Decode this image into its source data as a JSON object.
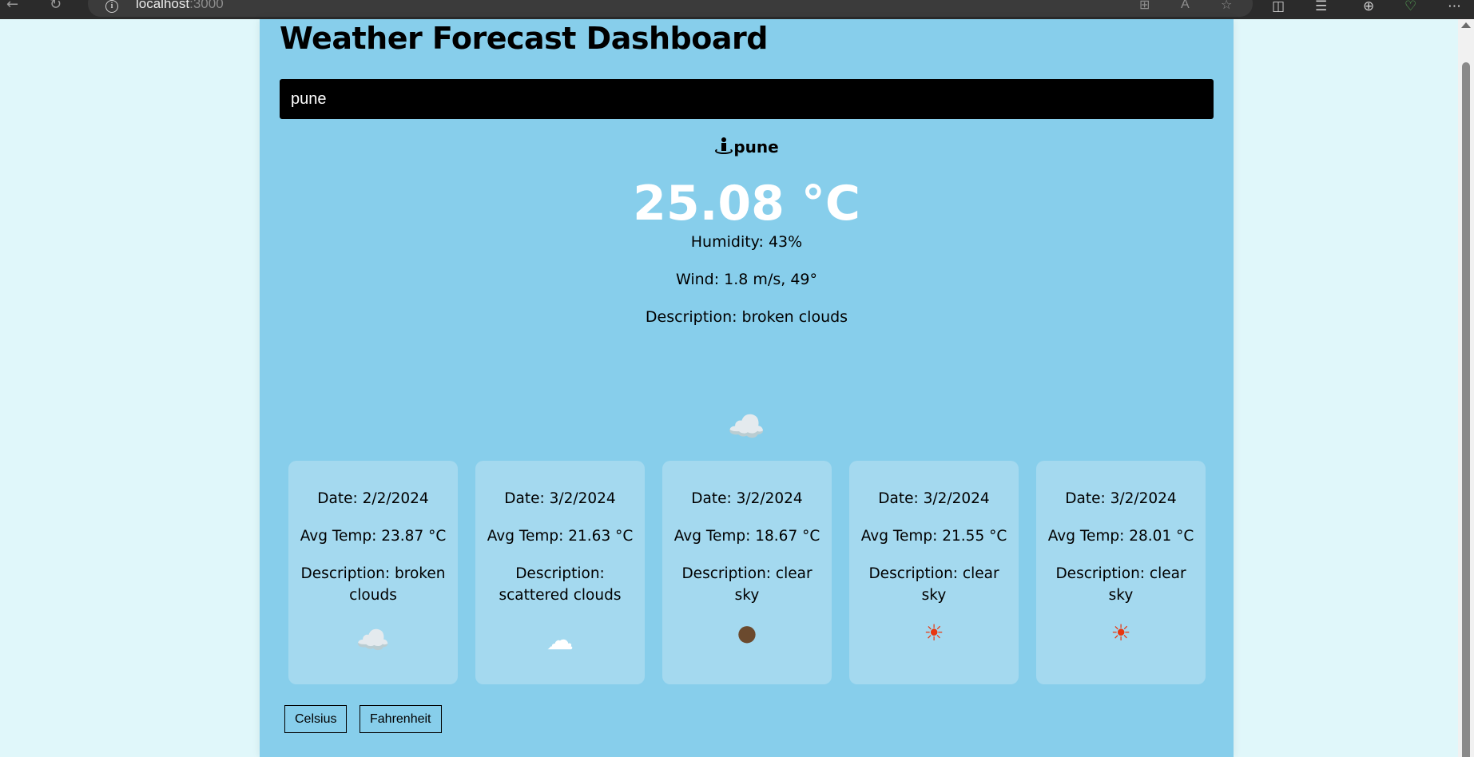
{
  "browser": {
    "url_host": "localhost",
    "url_port": ":3000",
    "back_icon": "back-arrow-icon",
    "reload_icon": "reload-icon"
  },
  "page": {
    "title": "Weather Forecast Dashboard",
    "search_value": "pune"
  },
  "current": {
    "city": "pune",
    "temperature": "25.08 °C",
    "humidity": "Humidity: 43%",
    "wind": "Wind: 1.8 m/s, 49°",
    "description": "Description: broken clouds",
    "icon": "broken-clouds-icon",
    "icon_glyph": "☁️"
  },
  "forecast": [
    {
      "date": "Date: 2/2/2024",
      "avg_temp": "Avg Temp: 23.87 °C",
      "description": "Description: broken clouds",
      "icon": "broken-clouds-icon",
      "icon_glyph": "☁️"
    },
    {
      "date": "Date: 3/2/2024",
      "avg_temp": "Avg Temp: 21.63 °C",
      "description": "Description: scattered clouds",
      "icon": "scattered-clouds-icon",
      "icon_glyph": "☁"
    },
    {
      "date": "Date: 3/2/2024",
      "avg_temp": "Avg Temp: 18.67 °C",
      "description": "Description: clear sky",
      "icon": "clear-sky-night-icon",
      "icon_glyph": "●"
    },
    {
      "date": "Date: 3/2/2024",
      "avg_temp": "Avg Temp: 21.55 °C",
      "description": "Description: clear sky",
      "icon": "clear-sky-sun-icon",
      "icon_glyph": "☀"
    },
    {
      "date": "Date: 3/2/2024",
      "avg_temp": "Avg Temp: 28.01 °C",
      "description": "Description: clear sky",
      "icon": "clear-sky-sun-icon",
      "icon_glyph": "☀"
    }
  ],
  "units": {
    "celsius_label": "Celsius",
    "fahrenheit_label": "Fahrenheit"
  },
  "colors": {
    "page_background": "#e0f7fa",
    "panel_background": "#87ceeb",
    "card_background": "#a4d9ef",
    "search_background": "#000000"
  }
}
